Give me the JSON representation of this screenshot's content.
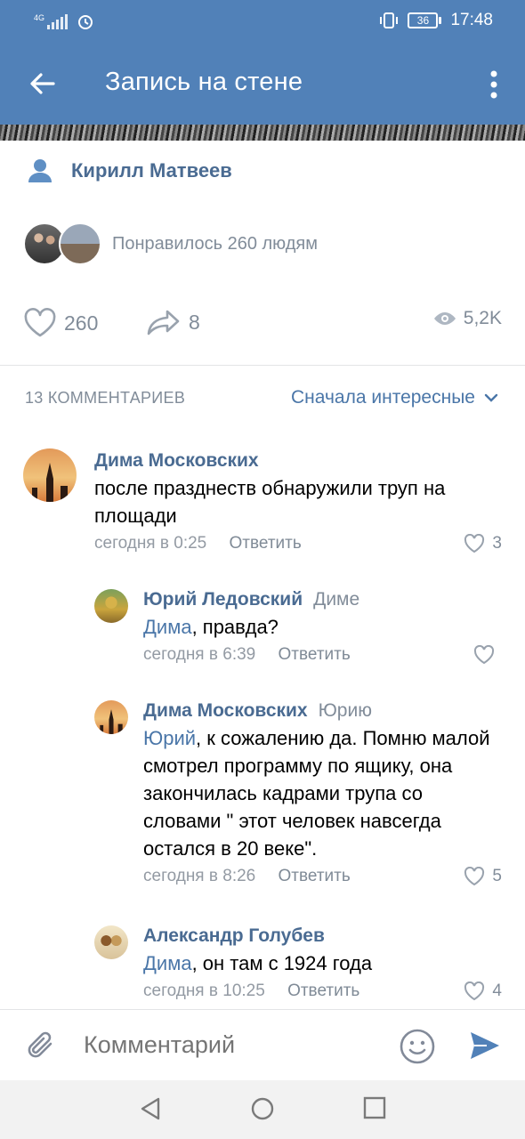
{
  "status_bar": {
    "network": "4G",
    "battery": "36",
    "time": "17:48"
  },
  "header": {
    "title": "Запись на стене"
  },
  "post": {
    "author": "Кирилл Матвеев",
    "liked_by_text": "Понравилось 260 людям",
    "likes": "260",
    "shares": "8",
    "views": "5,2K"
  },
  "comments_header": {
    "count_label": "13 КОММЕНТАРИЕВ",
    "sort_label": "Сначала интересные"
  },
  "comments": [
    {
      "name": "Дима Московских",
      "reply_to": "",
      "mention": "",
      "text": "после празднеств обнаружили труп на площади",
      "time": "сегодня в 0:25",
      "reply_label": "Ответить",
      "likes": "3"
    },
    {
      "name": "Юрий Ледовский",
      "reply_to": "Диме",
      "mention": "Дима",
      "text": ", правда?",
      "time": "сегодня в 6:39",
      "reply_label": "Ответить",
      "likes": ""
    },
    {
      "name": "Дима Московских",
      "reply_to": "Юрию",
      "mention": "Юрий",
      "text": ", к сожалению да. Помню малой смотрел программу по ящику, она закончилась кадрами трупа со словами \" этот человек навсегда остался в 20 веке\".",
      "time": "сегодня в 8:26",
      "reply_label": "Ответить",
      "likes": "5"
    },
    {
      "name": "Александр Голубев",
      "reply_to": "",
      "mention": "Дима",
      "text": ", он там с 1924 года",
      "time": "сегодня в 10:25",
      "reply_label": "Ответить",
      "likes": "4"
    }
  ],
  "input": {
    "placeholder": "Комментарий"
  },
  "colors": {
    "brand": "#5181b8",
    "link": "#4a76a8",
    "secondary": "#818c99"
  }
}
